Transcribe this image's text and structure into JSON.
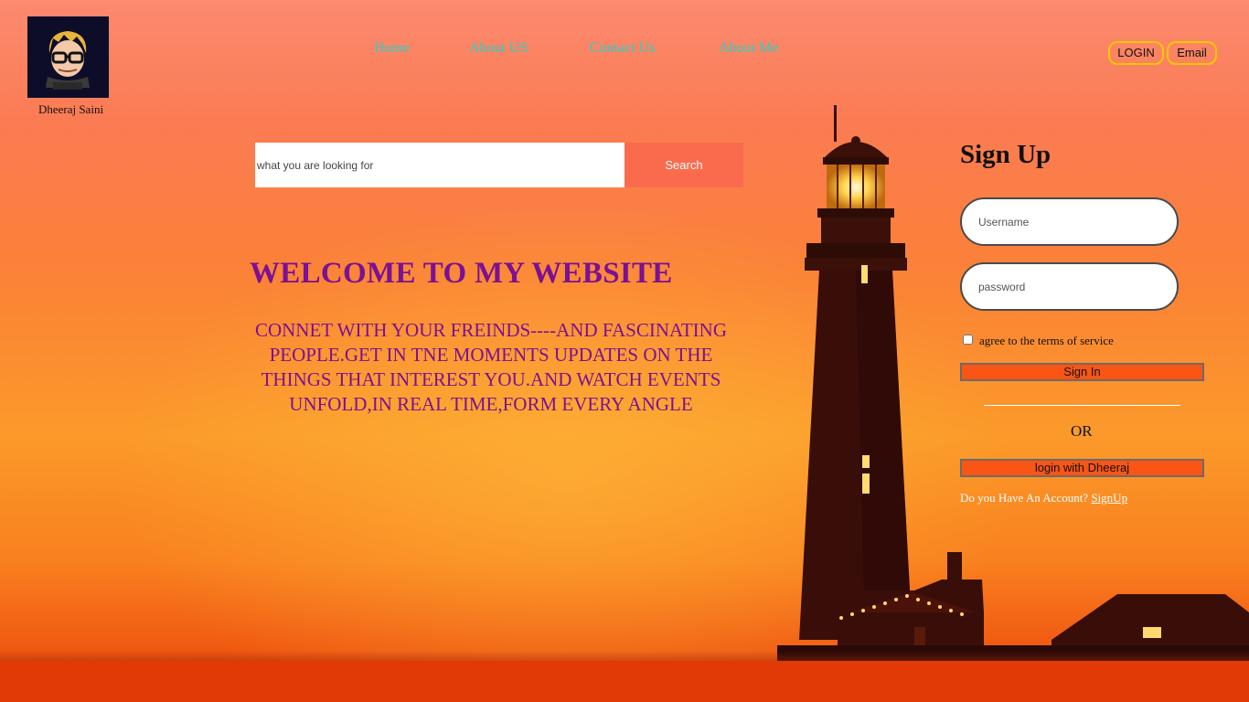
{
  "brand": {
    "name": "Dheeraj Saini",
    "logo_icon": "avatar-cartoon-glasses-icon"
  },
  "nav": {
    "items": [
      {
        "label": "Home"
      },
      {
        "label": "About US"
      },
      {
        "label": "Contact Us"
      },
      {
        "label": "About Me"
      }
    ],
    "login_label": "LOGIN",
    "email_label": "Email"
  },
  "search": {
    "placeholder": "what you are looking for",
    "button_label": "Search"
  },
  "hero": {
    "title": "WELCOME TO MY WEBSITE",
    "tagline": "CONNET WITH YOUR FREINDS----AND FASCINATING PEOPLE.GET IN TNE MOMENTS UPDATES ON THE THINGS THAT INTEREST YOU.AND WATCH EVENTS UNFOLD,IN REAL TIME,FORM EVERY ANGLE"
  },
  "signup": {
    "title": "Sign Up",
    "username_placeholder": "Username",
    "password_placeholder": "password",
    "terms_label": "agree to the terms of service",
    "signin_label": "Sign In",
    "or_text": "OR",
    "alt_login_label": "login with Dheeraj",
    "account_question": "Do you Have An Account?",
    "signup_link": "SignUp"
  },
  "colors": {
    "accent_purple": "#7b1193",
    "nav_teal": "#2bd0c5",
    "button_orange": "#fa5514",
    "search_button": "#fa6b4d",
    "border_yellow": "#f5c800"
  }
}
